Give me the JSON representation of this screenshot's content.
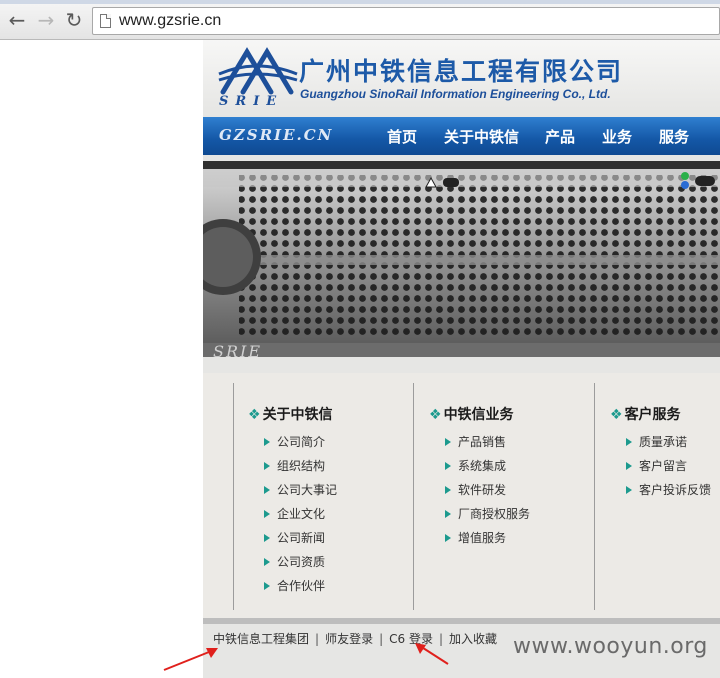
{
  "browser": {
    "url": "www.gzsrie.cn",
    "back_icon": "arrow-left-icon",
    "forward_icon": "arrow-right-icon",
    "reload_icon": "reload-icon"
  },
  "header": {
    "logo_letters": "SRIE",
    "company_cn": "广州中铁信息工程有限公司",
    "company_en": "Guangzhou SinoRail Information Engineering Co., Ltd."
  },
  "navbar": {
    "brand": "GZSRIE.CN",
    "items": [
      "首页",
      "关于中铁信",
      "产品",
      "业务",
      "服务"
    ]
  },
  "banner": {
    "overlay_text": "SRIE"
  },
  "columns": [
    {
      "title": "关于中铁信",
      "links": [
        "公司简介",
        "组织结构",
        "公司大事记",
        "企业文化",
        "公司新闻",
        "公司资质",
        "合作伙伴"
      ]
    },
    {
      "title": "中铁信业务",
      "links": [
        "产品销售",
        "系统集成",
        "软件研发",
        "厂商授权服务",
        "增值服务"
      ]
    },
    {
      "title": "客户服务",
      "links": [
        "质量承诺",
        "客户留言",
        "客户投诉反馈"
      ]
    }
  ],
  "footer": {
    "items": [
      "中铁信息工程集团",
      "师友登录",
      "C6 登录",
      "加入收藏"
    ],
    "separator": "|"
  },
  "watermark": "www.wooyun.org",
  "colors": {
    "nav_blue": "#1457a6",
    "accent_teal": "#1c9a8e",
    "annotation_red": "#e0201c"
  }
}
